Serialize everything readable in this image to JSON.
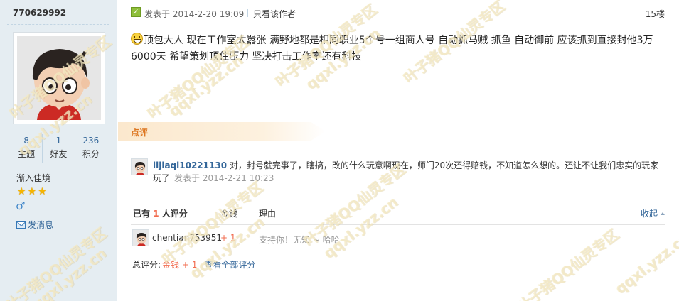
{
  "author": {
    "username": "770629992",
    "stats": [
      {
        "value": "8",
        "label": "主题"
      },
      {
        "value": "1",
        "label": "好友"
      },
      {
        "value": "236",
        "label": "积分"
      }
    ],
    "group": "渐入佳境",
    "stars": 3,
    "gender_icon": "male-icon",
    "send_message_label": "发消息"
  },
  "post": {
    "posted_label": "发表于 2014-2-20 19:09",
    "only_author_label": "只看该作者",
    "floor": "15楼",
    "body": "顶包大人 现在工作室太嚣张 满野地都是相同职业5个号一组商人号 自动抓马贼 抓鱼 自动御前 应该抓到直接封他3万6000天  希望策划顶住压力 坚决打击工作室还有科技"
  },
  "comments": {
    "heading": "点评",
    "items": [
      {
        "author": "lijiaqi10221130",
        "text": " 对，封号就完事了，瞎搞，改的什么玩意啊现在，师门20次还得赔钱，不知道怎么想的。还让不让我们忠实的玩家玩了",
        "meta": "发表于 2014-2-21 10:23"
      }
    ]
  },
  "rating": {
    "prefix": "已有",
    "count": "1",
    "suffix": "人评分",
    "col_money": "金钱",
    "col_reason": "理由",
    "collapse_label": "收起",
    "rows": [
      {
        "user": "chentian753951",
        "score": "+ 1",
        "reason": "支持你！无知 ~ 哈哈"
      }
    ],
    "total_label": "总评分:",
    "total_value": "金钱 + 1",
    "view_all_label": "查看全部评分"
  },
  "watermark": {
    "text_cn": "叶子猪QQ仙灵专区",
    "text_url": "qqxl.yzz.cn"
  },
  "colors": {
    "sidebar_bg": "#e5edf2",
    "link": "#336699",
    "accent_orange": "#dd7722",
    "score_red": "#f26c4f"
  }
}
